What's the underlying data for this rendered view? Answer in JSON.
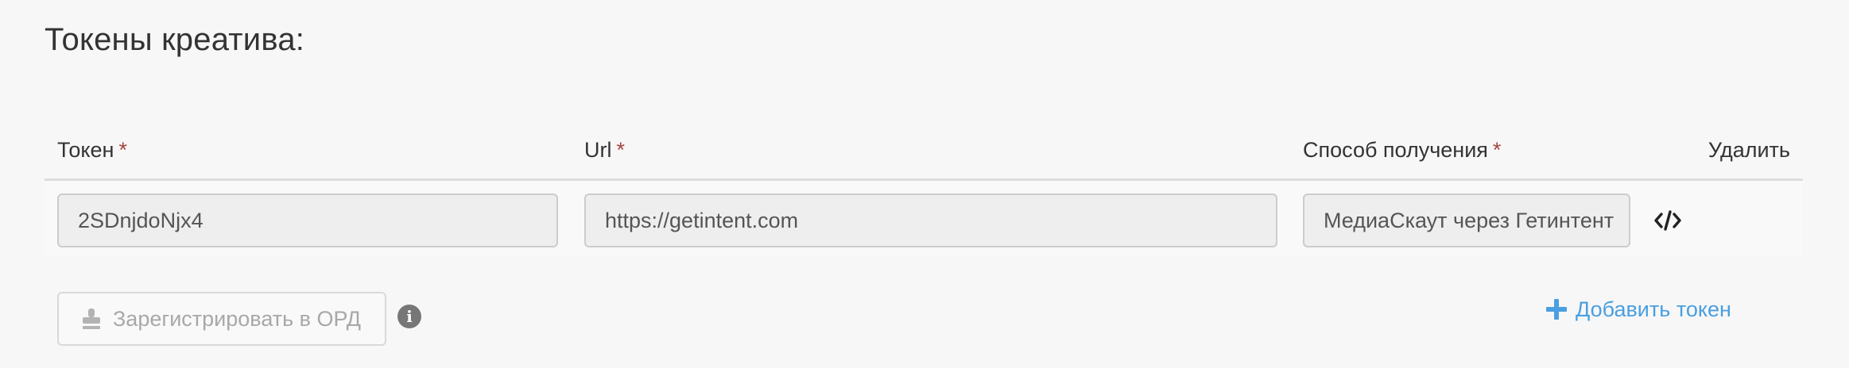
{
  "section": {
    "title": "Токены креатива:"
  },
  "table": {
    "headers": {
      "token": "Токен",
      "url": "Url",
      "method": "Способ получения",
      "delete": "Удалить",
      "required_mark": "*"
    },
    "rows": [
      {
        "token": "2SDnjdoNjx4",
        "url": "https://getintent.com",
        "method": "МедиаСкаут через Гетинтент"
      }
    ]
  },
  "actions": {
    "register_label": "Зарегистрировать в ОРД",
    "add_token_label": "Добавить токен"
  },
  "icons": {
    "code": "code-icon",
    "stamp": "stamp-icon",
    "info": "info-icon",
    "plus": "plus-icon"
  },
  "colors": {
    "accent": "#4a9fe0",
    "required": "#a94442",
    "field_bg": "#eeeeee",
    "page_bg": "#f7f7f7"
  }
}
